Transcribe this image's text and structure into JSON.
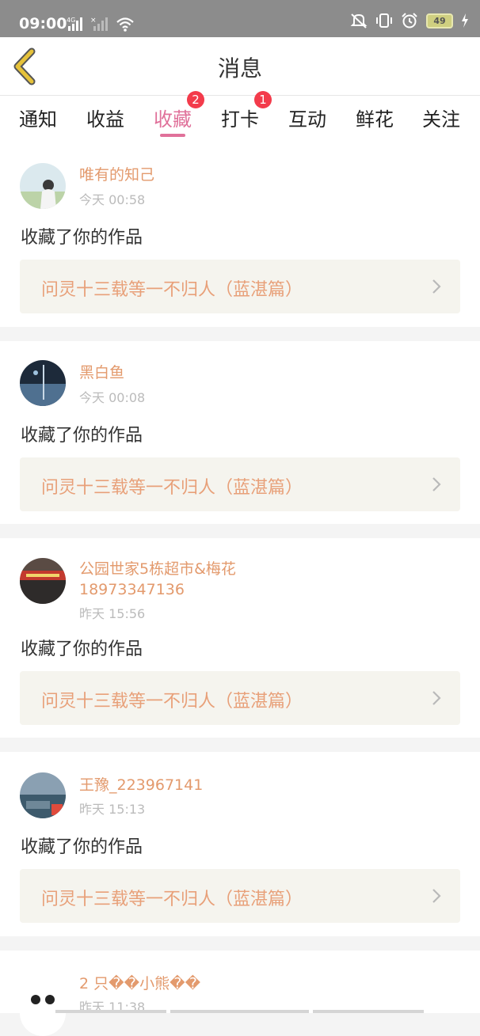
{
  "status_bar": {
    "time": "09:00",
    "network": "4G",
    "battery": "49"
  },
  "header": {
    "title": "消息"
  },
  "tabs": [
    {
      "label": "通知",
      "active": false
    },
    {
      "label": "收益",
      "active": false
    },
    {
      "label": "收藏",
      "active": true,
      "badge": "2"
    },
    {
      "label": "打卡",
      "active": false,
      "badge": "1"
    },
    {
      "label": "互动",
      "active": false
    },
    {
      "label": "鲜花",
      "active": false
    },
    {
      "label": "关注",
      "active": false
    }
  ],
  "messages": [
    {
      "user": "唯有的知己",
      "time": "今天 00:58",
      "action": "收藏了你的作品",
      "work_title": "问灵十三载等一不归人（蓝湛篇）"
    },
    {
      "user": "黑白鱼",
      "time": "今天 00:08",
      "action": "收藏了你的作品",
      "work_title": "问灵十三载等一不归人（蓝湛篇）"
    },
    {
      "user_line1": "公园世家5栋超市&梅花",
      "user_line2": "18973347136",
      "time": "昨天 15:56",
      "action": "收藏了你的作品",
      "work_title": "问灵十三载等一不归人（蓝湛篇）"
    },
    {
      "user": "王豫_223967141",
      "time": "昨天 15:13",
      "action": "收藏了你的作品",
      "work_title": "问灵十三载等一不归人（蓝湛篇）"
    },
    {
      "user": "2 只��小熊��",
      "time": "昨天 11:38"
    }
  ],
  "colors": {
    "accent": "#e0719a",
    "username": "#e39a6d",
    "work_title": "#e8a079",
    "badge": "#f33b4b",
    "back_arrow": "#e6c23a"
  }
}
